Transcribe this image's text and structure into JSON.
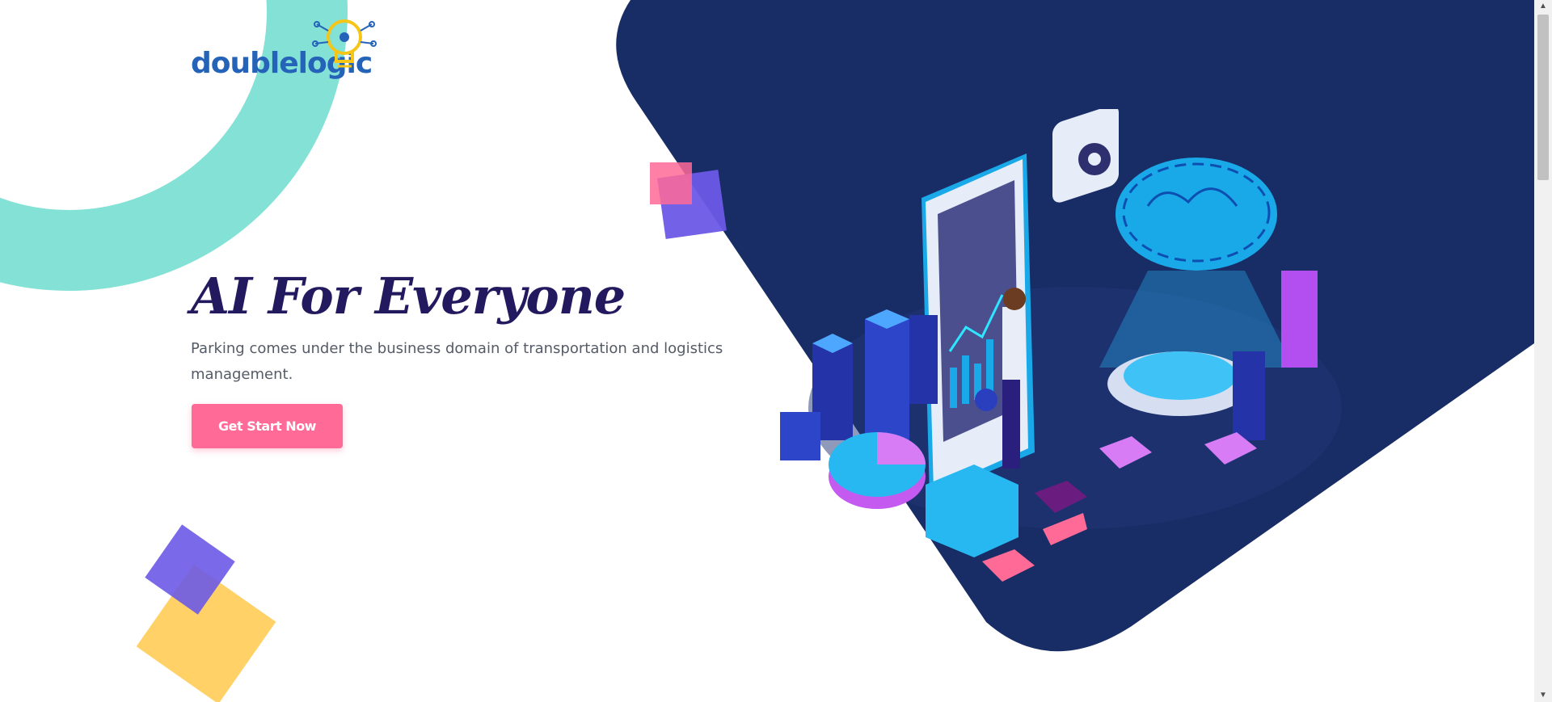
{
  "brand": {
    "name": "doublelogic"
  },
  "hero": {
    "title": "AI For Everyone",
    "description": "Parking comes under the business domain of transportation and logistics management.",
    "cta_label": "Get Start Now"
  },
  "colors": {
    "navy": "#182c66",
    "teal": "#84e1d5",
    "pink": "#ff6a96",
    "violet": "#6b59e6",
    "yellow": "#ffd166",
    "title": "#23195f"
  },
  "icons": [
    "gear-icon",
    "brain-icon",
    "bulb-icon",
    "pie-chart-icon",
    "bar-chart-icon"
  ],
  "scrollbar": {
    "up": "▲",
    "down": "▼"
  }
}
